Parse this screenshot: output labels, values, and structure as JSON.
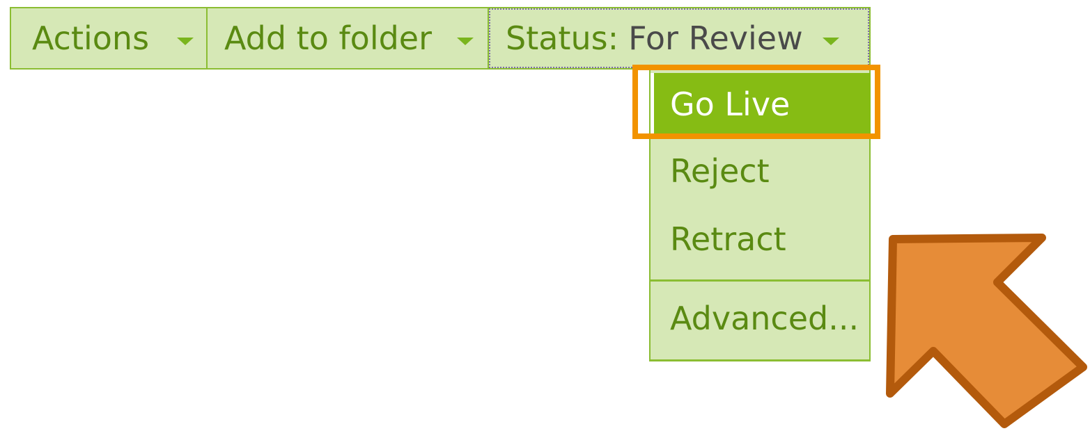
{
  "toolbar": {
    "actions_label": "Actions",
    "folder_label": "Add to folder",
    "status_label": "Status:",
    "status_value": "For Review"
  },
  "menu": {
    "items": [
      {
        "label": "Go Live"
      },
      {
        "label": "Reject"
      },
      {
        "label": "Retract"
      },
      {
        "label": "Advanced..."
      }
    ]
  },
  "colors": {
    "toolbar_bg": "#d6e8b6",
    "border": "#8bbd32",
    "text_green": "#5a8a12",
    "selected_bg": "#86bc14",
    "highlight": "#f29300",
    "arrow_fill": "#e68c38",
    "arrow_stroke": "#b35a0c"
  }
}
